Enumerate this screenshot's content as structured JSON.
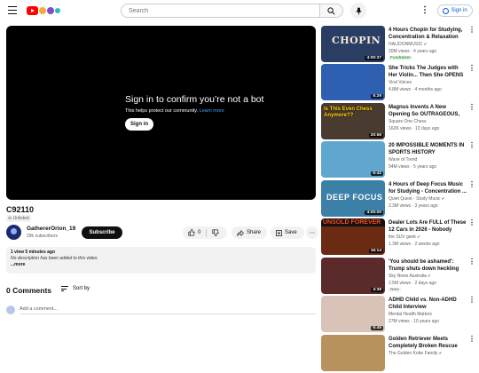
{
  "header": {
    "search_placeholder": "Search",
    "signin_label": "Sign in"
  },
  "player": {
    "headline": "Sign in to confirm you’re not a bot",
    "subtext": "This helps protect our community.",
    "learn_more": "Learn more",
    "signin_label": "Sign in"
  },
  "video": {
    "title": "C92110",
    "visibility": "Unlisted",
    "channel": "GathererOrion_19",
    "subscribers": "29k subscribers",
    "subscribe_label": "Subscribe",
    "likes": "0",
    "share_label": "Share",
    "save_label": "Save",
    "meta": "1 view  5 minutes ago",
    "description": "No description has been added to this video.",
    "more_label": "...more"
  },
  "comments": {
    "count_label": "0 Comments",
    "sort_label": "Sort by",
    "add_placeholder": "Add a comment..."
  },
  "recommended": [
    {
      "title": "4 Hours Chopin for Studying, Concentration & Relaxation",
      "channel": "HALIDONMUSIC",
      "verified": true,
      "views": "20M views · 4 years ago",
      "duration": "4:00:37",
      "badge": "Fundraiser",
      "thumb_text": "CHOPIN",
      "thumb_color": "#2a3e63"
    },
    {
      "title": "She Tricks The Judges with Her Violin... Then She OPENS Her ...",
      "channel": "Viral Voices",
      "verified": false,
      "views": "4.8M views · 4 months ago",
      "duration": "5:29",
      "badge": "",
      "thumb_text": "",
      "thumb_color": "#2f5fb0"
    },
    {
      "title": "Magnus Invents A New Opening So OUTRAGEOUS, You'll ...",
      "channel": "Square One Chess",
      "verified": false,
      "views": "162K views · 13 days ago",
      "duration": "20:58",
      "badge": "",
      "thumb_text": "Is This Even Chess Anymore??",
      "thumb_color": "#4a3b30"
    },
    {
      "title": "20 IMPOSSIBLE MOMENTS IN SPORTS HISTORY",
      "channel": "Wave of Trend",
      "verified": false,
      "views": "54M views · 5 years ago",
      "duration": "6:42",
      "badge": "",
      "thumb_text": "",
      "thumb_color": "#5fa7cf"
    },
    {
      "title": "4 Hours of Deep Focus Music for Studying - Concentration ...",
      "channel": "Quiet Quest - Study Music",
      "verified": true,
      "views": "2.3M views · 3 years ago",
      "duration": "4:00:00",
      "badge": "",
      "thumb_text": "DEEP FOCUS",
      "thumb_color": "#3c80a8"
    },
    {
      "title": "Dealer Lots Are FULL of These 12 Cars in 2026 - Nobody Wan...",
      "channel": "the SUV geek",
      "verified": true,
      "views": "1.3M views · 2 weeks ago",
      "duration": "16:14",
      "badge": "",
      "thumb_text": "UNSOLD FOREVER",
      "thumb_color": "#6b2a12"
    },
    {
      "title": "'You should be ashamed': Trump shuts down heckling Ilhan Omar",
      "channel": "Sky News Australia",
      "verified": true,
      "views": "2.5M views · 2 days ago",
      "duration": "4:38",
      "badge": "New",
      "thumb_text": "",
      "thumb_color": "#5b2b2b"
    },
    {
      "title": "ADHD Child vs. Non-ADHD Child Interview",
      "channel": "Mental Health Matters",
      "verified": false,
      "views": "27M views · 10 years ago",
      "duration": "6:45",
      "badge": "",
      "thumb_text": "",
      "thumb_color": "#d9c3b8"
    },
    {
      "title": "Golden Retriever Meets Completely Broken Rescue for...",
      "channel": "The Golden Kobe Family",
      "verified": true,
      "views": "",
      "duration": "",
      "badge": "",
      "thumb_text": "",
      "thumb_color": "#b8925c"
    }
  ],
  "colors": {
    "accent": "#065fd4",
    "brand": "#ff0000",
    "dark": "#0f0f0f",
    "muted": "#606060"
  }
}
